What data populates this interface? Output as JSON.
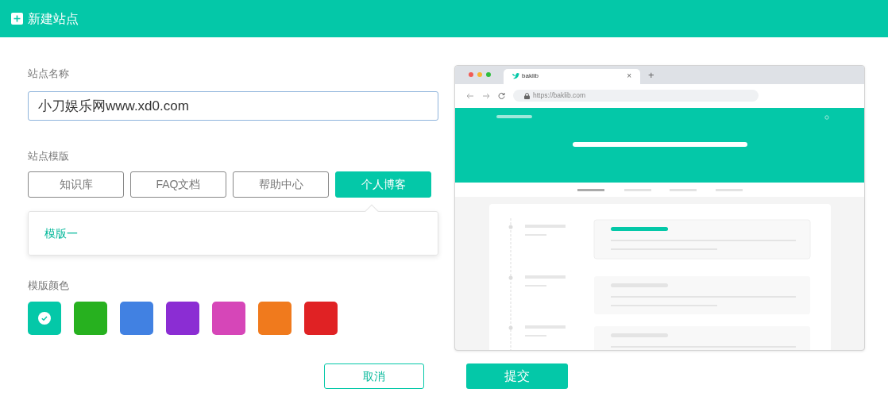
{
  "header": {
    "title": "新建站点"
  },
  "site_name": {
    "label": "站点名称",
    "value": "小刀娱乐网www.xd0.com"
  },
  "template": {
    "label": "站点模版",
    "tabs": [
      {
        "label": "知识库",
        "selected": false
      },
      {
        "label": "FAQ文档",
        "selected": false
      },
      {
        "label": "帮助中心",
        "selected": false
      },
      {
        "label": "个人博客",
        "selected": true
      }
    ],
    "options": [
      {
        "label": "模版一"
      }
    ]
  },
  "color": {
    "label": "模版颜色",
    "swatches": [
      {
        "color": "#04c8a8",
        "selected": true
      },
      {
        "color": "#27b11f",
        "selected": false
      },
      {
        "color": "#4181e2",
        "selected": false
      },
      {
        "color": "#8b2dd3",
        "selected": false
      },
      {
        "color": "#d646b8",
        "selected": false
      },
      {
        "color": "#f07a1d",
        "selected": false
      },
      {
        "color": "#e02224",
        "selected": false
      }
    ]
  },
  "preview": {
    "tab_title": "baklib",
    "close": "×",
    "new_tab": "+",
    "url": "https://baklib.com"
  },
  "buttons": [
    {
      "label": "取消",
      "kind": "secondary"
    },
    {
      "label": "提交",
      "kind": "primary"
    }
  ]
}
